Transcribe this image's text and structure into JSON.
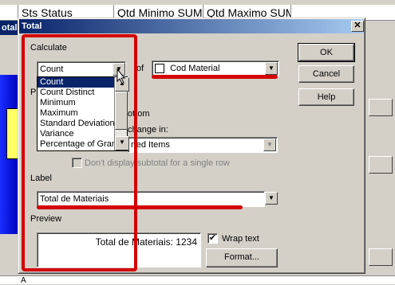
{
  "background": {
    "columns": [
      "Sts Status",
      "Qtd Minimo SUM",
      "Qtd Maximo SUM"
    ],
    "left_tab": "otals",
    "bottom_row_text": "A"
  },
  "dialog": {
    "title": "Total",
    "close_glyph": "✕",
    "calculate": {
      "group_label": "Calculate",
      "function_value": "Count",
      "of_label": "of",
      "field_value": "Cod Material",
      "options": [
        "Count",
        "Count Distinct",
        "Minimum",
        "Maximum",
        "Standard Deviation",
        "Variance",
        "Percentage of Gran"
      ]
    },
    "placement": {
      "group_label_partial": "P",
      "bottom_text": "ottom",
      "change_in_text": "change in:",
      "sorted_items_value": "rted Items",
      "dont_display": "Don't display subtotal for a single row"
    },
    "label": {
      "group_label": "Label",
      "value": "Total de Materiais"
    },
    "preview": {
      "group_label": "Preview",
      "text": "Total de Materiais: 1234",
      "wrap_text_label": "Wrap text",
      "wrap_text_checked": true,
      "format_button": "Format..."
    },
    "buttons": {
      "ok": "OK",
      "cancel": "Cancel",
      "help": "Help"
    }
  },
  "colors": {
    "highlight_red": "#d40000",
    "selection_blue": "#0a246a",
    "title_gradient_start": "#0a246a",
    "title_gradient_end": "#a6caf0"
  }
}
